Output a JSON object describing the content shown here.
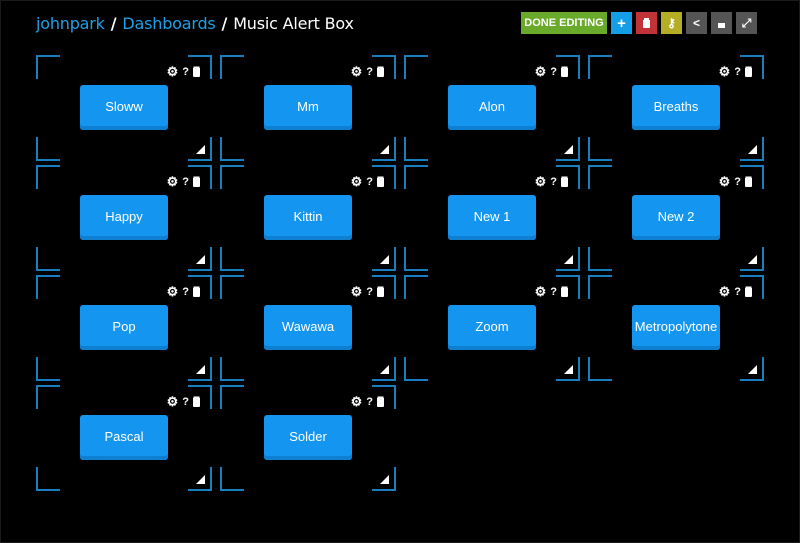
{
  "breadcrumb": {
    "user": "johnpark",
    "section": "Dashboards",
    "current": "Music Alert Box",
    "separator": "/"
  },
  "toolbar": {
    "done_label": "DONE EDITING",
    "buttons": [
      {
        "name": "add",
        "icon": "plus-icon",
        "glyph": "+",
        "color": "#149ee8"
      },
      {
        "name": "delete",
        "icon": "trash-icon",
        "glyph": "🗑",
        "color": "#c13336"
      },
      {
        "name": "key",
        "icon": "key-icon",
        "glyph": "⚷",
        "color": "#b4ad25"
      },
      {
        "name": "share",
        "icon": "share-icon",
        "glyph": "<",
        "color": "#555555"
      },
      {
        "name": "unlock",
        "icon": "unlock-icon",
        "glyph": "🔓",
        "color": "#555555"
      },
      {
        "name": "fullscreen",
        "icon": "expand-icon",
        "glyph": "⤢",
        "color": "#555555"
      }
    ]
  },
  "block_tools": {
    "gear": "⚙",
    "help": "?",
    "trash": "🗑"
  },
  "blocks": [
    {
      "label": "Sloww"
    },
    {
      "label": "Mm"
    },
    {
      "label": "Alon"
    },
    {
      "label": "Breaths"
    },
    {
      "label": "Happy"
    },
    {
      "label": "Kittin"
    },
    {
      "label": "New 1"
    },
    {
      "label": "New 2"
    },
    {
      "label": "Pop"
    },
    {
      "label": "Wawawa"
    },
    {
      "label": "Zoom"
    },
    {
      "label": "Metropolytone"
    },
    {
      "label": "Pascal"
    },
    {
      "label": "Solder"
    }
  ],
  "colors": {
    "accent": "#1ea0e6",
    "button": "#1496f0",
    "block_border": "#1a7fbf",
    "done": "#6aaa2a"
  }
}
